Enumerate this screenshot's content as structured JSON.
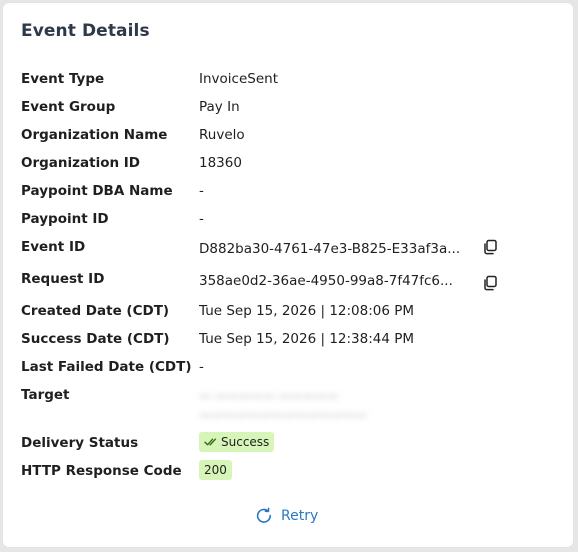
{
  "panel": {
    "title": "Event Details"
  },
  "fields": {
    "event_type": {
      "label": "Event Type",
      "value": "InvoiceSent"
    },
    "event_group": {
      "label": "Event Group",
      "value": "Pay In"
    },
    "organization_name": {
      "label": "Organization Name",
      "value": "Ruvelo"
    },
    "organization_id": {
      "label": "Organization ID",
      "value": "18360"
    },
    "paypoint_dba_name": {
      "label": "Paypoint DBA Name",
      "value": "-"
    },
    "paypoint_id": {
      "label": "Paypoint ID",
      "value": "-"
    },
    "event_id": {
      "label": "Event ID",
      "value": "D882ba30-4761-47e3-B825-E33af3a..."
    },
    "request_id": {
      "label": "Request ID",
      "value": "358ae0d2-36ae-4950-99a8-7f47fc6..."
    },
    "created_date": {
      "label": "Created Date (CDT)",
      "value": "Tue Sep 15, 2026 | 12:08:06 PM"
    },
    "success_date": {
      "label": "Success Date (CDT)",
      "value": "Tue Sep 15, 2026 | 12:38:44 PM"
    },
    "last_failed_date": {
      "label": "Last Failed Date (CDT)",
      "value": "-"
    },
    "target": {
      "label": "Target"
    },
    "delivery_status": {
      "label": "Delivery Status",
      "value": "Success"
    },
    "http_response_code": {
      "label": "HTTP Response Code",
      "value": "200"
    }
  },
  "actions": {
    "retry_label": "Retry"
  },
  "icons": {
    "copy": "copy-icon",
    "check": "double-check-icon",
    "retry": "refresh-icon"
  },
  "colors": {
    "badge_bg": "#d7f5b8",
    "link": "#2b78c2",
    "title": "#2e3a48"
  }
}
